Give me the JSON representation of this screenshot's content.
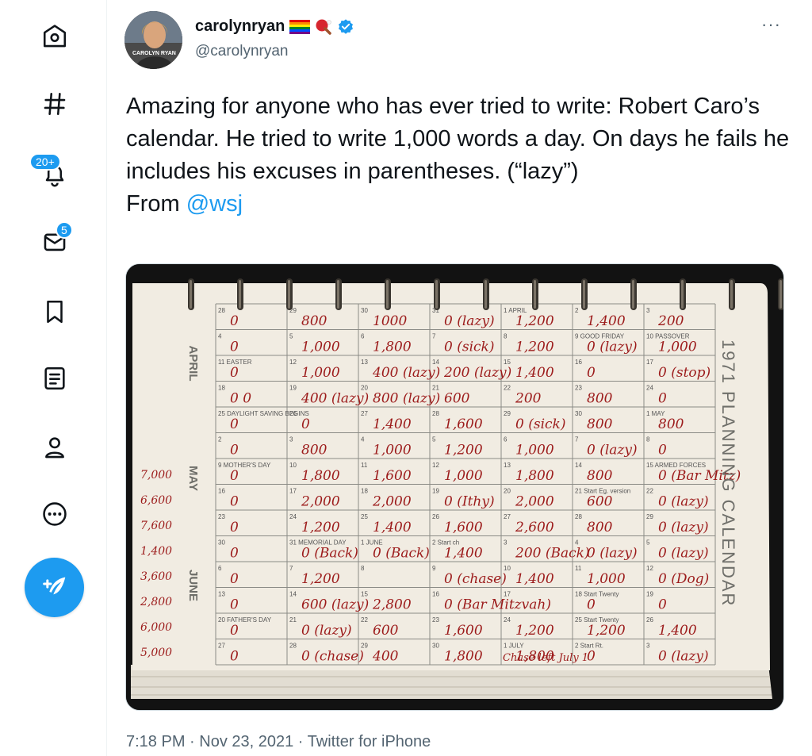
{
  "nav": {
    "items": [
      {
        "name": "home",
        "icon": "home-icon"
      },
      {
        "name": "explore",
        "icon": "hashtag-icon"
      },
      {
        "name": "notifications",
        "icon": "bell-icon",
        "badge": "20+"
      },
      {
        "name": "messages",
        "icon": "envelope-icon",
        "badge": "5"
      },
      {
        "name": "bookmarks",
        "icon": "bookmark-icon"
      },
      {
        "name": "lists",
        "icon": "list-icon"
      },
      {
        "name": "profile",
        "icon": "person-icon"
      },
      {
        "name": "more",
        "icon": "more-circle-icon"
      }
    ],
    "compose_icon": "compose-feather-icon"
  },
  "tweet": {
    "author": {
      "display_name": "carolynryan",
      "handle": "@carolynryan",
      "emoji": [
        "rainbow-flag-icon",
        "ping-pong-icon"
      ],
      "verified_icon": "verified-badge-icon",
      "avatar_caption": "CAROLYN RYAN"
    },
    "more_label": "···",
    "text_main": "Amazing for anyone who has ever tried to write: Robert Caro’s calendar. He tried to write 1,000 words a day. On days he fails he includes his excuses in parentheses. (“lazy”)\nFrom ",
    "mention": "@wsj",
    "time": "7:18 PM",
    "date": "Nov 23, 2021",
    "source": "Twitter for iPhone",
    "sep": " · "
  },
  "photo": {
    "calendar_title": "1971 PLANNING CALENDAR",
    "months": [
      "APRIL",
      "MAY",
      "JUNE"
    ],
    "margin_numbers": [
      "7,000",
      "6,600",
      "7,600",
      "1,400",
      "3,600",
      "2,800",
      "6,000",
      "5,000"
    ],
    "rows": [
      [
        [
          "28",
          "0"
        ],
        [
          "29",
          "800"
        ],
        [
          "30",
          "1000"
        ],
        [
          "31",
          "0 (lazy)"
        ],
        [
          "1 APRIL",
          "1,200"
        ],
        [
          "2",
          "1,400"
        ],
        [
          "3",
          "200"
        ]
      ],
      [
        [
          "4",
          "0"
        ],
        [
          "5",
          "1,000"
        ],
        [
          "6",
          "1,800"
        ],
        [
          "7",
          "0 (sick)"
        ],
        [
          "8",
          "1,200"
        ],
        [
          "9 GOOD FRIDAY",
          "0 (lazy)"
        ],
        [
          "10 PASSOVER",
          "1,000"
        ]
      ],
      [
        [
          "11 EASTER",
          "0"
        ],
        [
          "12",
          "1,000"
        ],
        [
          "13",
          "400 (lazy)"
        ],
        [
          "14",
          "200 (lazy)"
        ],
        [
          "15",
          "1,400"
        ],
        [
          "16",
          "0"
        ],
        [
          "17",
          "0 (stop)"
        ]
      ],
      [
        [
          "18",
          "0 0"
        ],
        [
          "19",
          "400 (lazy)"
        ],
        [
          "20",
          "800 (lazy)"
        ],
        [
          "21",
          "600"
        ],
        [
          "22",
          "200"
        ],
        [
          "23",
          "800"
        ],
        [
          "24",
          "0"
        ]
      ],
      [
        [
          "25 DAYLIGHT SAVING BEGINS",
          "0"
        ],
        [
          "26",
          "0"
        ],
        [
          "27",
          "1,400"
        ],
        [
          "28",
          "1,600"
        ],
        [
          "29",
          "0 (sick)"
        ],
        [
          "30",
          "800"
        ],
        [
          "1 MAY",
          "800"
        ]
      ],
      [
        [
          "2",
          "0"
        ],
        [
          "3",
          "800"
        ],
        [
          "4",
          "1,000"
        ],
        [
          "5",
          "1,200"
        ],
        [
          "6",
          "1,000"
        ],
        [
          "7",
          "0 (lazy)"
        ],
        [
          "8",
          "0"
        ]
      ],
      [
        [
          "9 MOTHER'S DAY",
          "0"
        ],
        [
          "10",
          "1,800"
        ],
        [
          "11",
          "1,600"
        ],
        [
          "12",
          "1,000"
        ],
        [
          "13",
          "1,800"
        ],
        [
          "14",
          "800"
        ],
        [
          "15 ARMED FORCES",
          "0 (Bar Mitz)"
        ]
      ],
      [
        [
          "16",
          "0"
        ],
        [
          "17",
          "2,000"
        ],
        [
          "18",
          "2,000"
        ],
        [
          "19",
          "0 (Ithy)"
        ],
        [
          "20",
          "2,000"
        ],
        [
          "21 Start Eg. version",
          "600"
        ],
        [
          "22",
          "0 (lazy)"
        ]
      ],
      [
        [
          "23",
          "0"
        ],
        [
          "24",
          "1,200"
        ],
        [
          "25",
          "1,400"
        ],
        [
          "26",
          "1,600"
        ],
        [
          "27",
          "2,600"
        ],
        [
          "28",
          "800"
        ],
        [
          "29",
          "0 (lazy)"
        ]
      ],
      [
        [
          "30",
          "0"
        ],
        [
          "31 MEMORIAL DAY",
          "0 (Back)"
        ],
        [
          "1 JUNE",
          "0 (Back)"
        ],
        [
          "2 Start ch",
          "1,400"
        ],
        [
          "3",
          "200 (Back)"
        ],
        [
          "4",
          "0 (lazy)"
        ],
        [
          "5",
          "0 (lazy)"
        ]
      ],
      [
        [
          "6",
          "0"
        ],
        [
          "7",
          "1,200"
        ],
        [
          "8",
          ""
        ],
        [
          "9",
          "0 (chase)"
        ],
        [
          "10",
          "1,400"
        ],
        [
          "11",
          "1,000"
        ],
        [
          "12",
          "0 (Dog)"
        ]
      ],
      [
        [
          "13",
          "0"
        ],
        [
          "14",
          "600 (lazy)"
        ],
        [
          "15",
          "2,800"
        ],
        [
          "16",
          "0 (Bar Mitzvah)"
        ],
        [
          "17",
          ""
        ],
        [
          "18 Start Twenty",
          "0"
        ],
        [
          "19",
          "0"
        ]
      ],
      [
        [
          "20 FATHER'S DAY",
          "0"
        ],
        [
          "21",
          "0 (lazy)"
        ],
        [
          "22",
          "600"
        ],
        [
          "23",
          "1,600"
        ],
        [
          "24",
          "1,200"
        ],
        [
          "25 Start Twenty",
          "1,200"
        ],
        [
          "26",
          "1,400"
        ]
      ],
      [
        [
          "27",
          "0"
        ],
        [
          "28",
          "0 (chase)"
        ],
        [
          "29",
          "400"
        ],
        [
          "30",
          "1,800"
        ],
        [
          "1 JULY",
          "1,800"
        ],
        [
          "2 Start Rt.",
          "0"
        ],
        [
          "3",
          "0 (lazy)"
        ]
      ]
    ],
    "bottom_note": "Chase left July 1"
  }
}
